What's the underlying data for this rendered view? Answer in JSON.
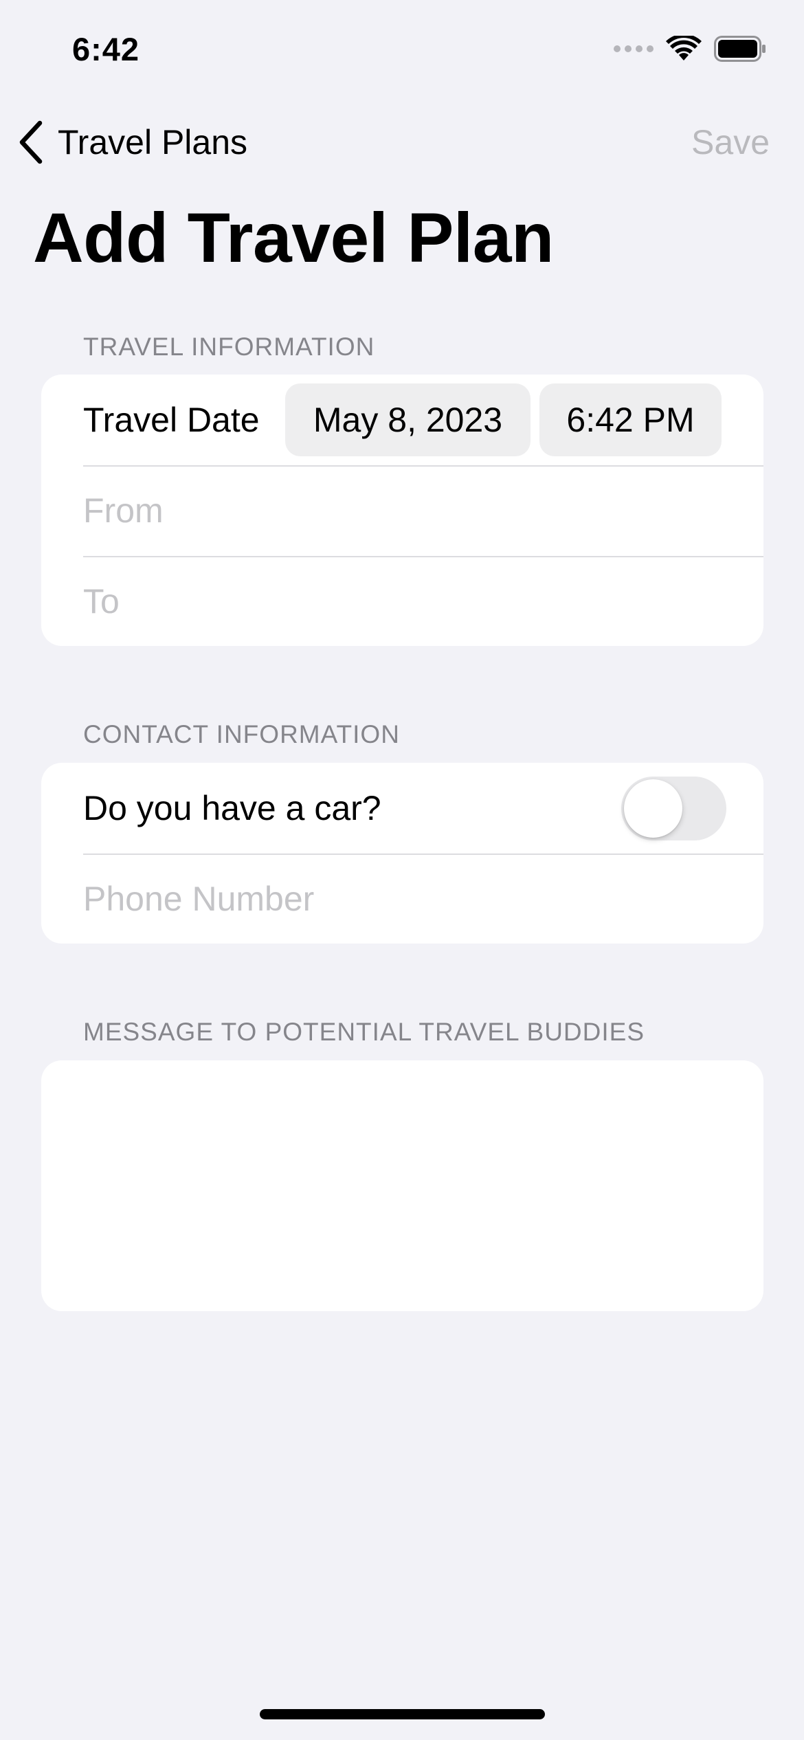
{
  "status_bar": {
    "time": "6:42",
    "icons": [
      "signal-icon",
      "wifi-icon",
      "battery-icon"
    ]
  },
  "nav": {
    "back_label": "Travel Plans",
    "save_label": "Save",
    "title": "Add Travel Plan"
  },
  "travel_section": {
    "header": "TRAVEL INFORMATION",
    "date_label": "Travel Date",
    "date_value": "May 8, 2023",
    "time_value": "6:42 PM",
    "from_placeholder": "From",
    "to_placeholder": "To"
  },
  "contact_section": {
    "header": "CONTACT INFORMATION",
    "car_label": "Do you have a car?",
    "car_toggle_on": false,
    "phone_placeholder": "Phone Number"
  },
  "message_section": {
    "header": "MESSAGE TO POTENTIAL TRAVEL BUDDIES",
    "value": ""
  },
  "colors": {
    "background": "#f2f2f7",
    "card": "#ffffff",
    "disabled_text": "#b9b9bd",
    "section_header": "#85858b",
    "placeholder": "#c4c4c7",
    "pill": "#eeeeef"
  }
}
